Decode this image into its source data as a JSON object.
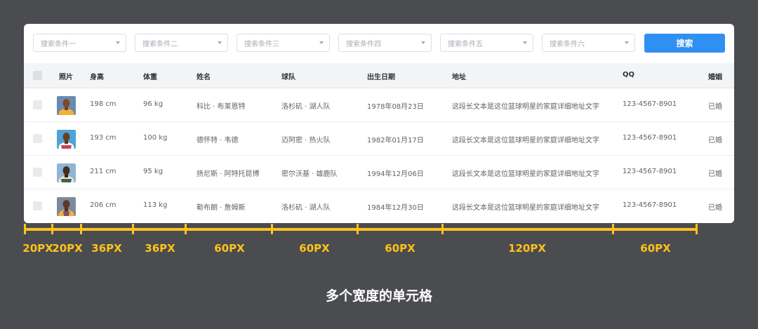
{
  "search": {
    "conditions": [
      "搜索条件一",
      "搜索条件二",
      "搜索条件三",
      "搜索条件四",
      "搜索条件五",
      "搜索条件六"
    ],
    "button_label": "搜索"
  },
  "table": {
    "headers": {
      "photo": "照片",
      "height": "身高",
      "weight": "体重",
      "name": "姓名",
      "team": "球队",
      "birth": "出生日期",
      "address": "地址",
      "qq": "QQ",
      "marital": "婚姻"
    },
    "rows": [
      {
        "height": "198 cm",
        "weight": "96 kg",
        "name": "科比 · 布莱恩特",
        "team": "洛杉矶 · 湖人队",
        "birth": "1978年08月23日",
        "address": "这段长文本是这位篮球明星的家庭详细地址文字",
        "qq": "123-4567-8901",
        "marital": "已婚"
      },
      {
        "height": "193 cm",
        "weight": "100 kg",
        "name": "德怀特 · 韦德",
        "team": "迈阿密 · 热火队",
        "birth": "1982年01月17日",
        "address": "这段长文本是这位篮球明星的家庭详细地址文字",
        "qq": "123-4567-8901",
        "marital": "已婚"
      },
      {
        "height": "211 cm",
        "weight": "95 kg",
        "name": "扬尼斯 · 阿特托昆博",
        "team": "密尔沃基 · 雄鹿队",
        "birth": "1994年12月06日",
        "address": "这段长文本是这位篮球明星的家庭详细地址文字",
        "qq": "123-4567-8901",
        "marital": "已婚"
      },
      {
        "height": "206 cm",
        "weight": "113 kg",
        "name": "勒布朗 · 詹姆斯",
        "team": "洛杉矶 · 湖人队",
        "birth": "1984年12月30日",
        "address": "这段长文本是这位篮球明星的家庭详细地址文字",
        "qq": "123-4567-8901",
        "marital": "已婚"
      }
    ]
  },
  "measure_labels": [
    "20PX",
    "20PX",
    "36PX",
    "36PX",
    "60PX",
    "60PX",
    "60PX",
    "120PX",
    "60PX"
  ],
  "caption": "多个宽度的单元格",
  "colors": {
    "background": "#4a4c50",
    "accent": "#ffc21a",
    "primary_button": "#2f8ff2",
    "jersey_lakers": "#f2b134",
    "jersey_heat": "#c8102e",
    "jersey_bucks": "#1e4d2b"
  }
}
